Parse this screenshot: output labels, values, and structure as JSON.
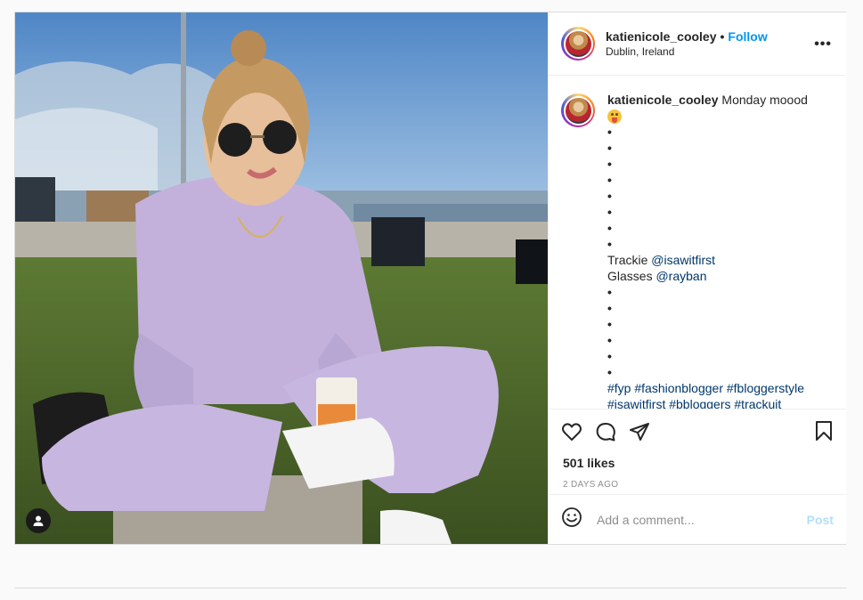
{
  "post": {
    "username": "katienicole_cooley",
    "separator": "•",
    "follow_label": "Follow",
    "location": "Dublin, Ireland",
    "more_label": "•••",
    "image_alt": "Woman in lilac sweatsuit sitting on grass with coffee cup by a harbour"
  },
  "caption": {
    "username": "katienicole_cooley",
    "text": "Monday moood",
    "emoji_icon": "face-with-tongue-icon",
    "dots_before": [
      "•",
      "•",
      "•",
      "•",
      "•",
      "•",
      "•",
      "•"
    ],
    "line_trackie_label": "Trackie",
    "line_trackie_mention": "@isawitfirst",
    "line_glasses_label": "Glasses",
    "line_glasses_mention": "@rayban",
    "dots_after": [
      "•",
      "•",
      "•",
      "•",
      "•",
      "•"
    ],
    "hashtags": "#fyp #fashionblogger #fbloggerstyle",
    "hashtags_cut": "#isawitfirst #bbloggers #trackuit"
  },
  "actions": {
    "like_icon": "heart-icon",
    "comment_icon": "comment-icon",
    "share_icon": "share-icon",
    "save_icon": "bookmark-icon"
  },
  "likes": "501 likes",
  "date": "2 DAYS AGO",
  "comment": {
    "placeholder": "Add a comment...",
    "post_label": "Post",
    "emoji_icon": "smiley-icon"
  },
  "colors": {
    "accent": "#0095f6",
    "link": "#00376b",
    "post_disabled": "#b2dffc"
  }
}
